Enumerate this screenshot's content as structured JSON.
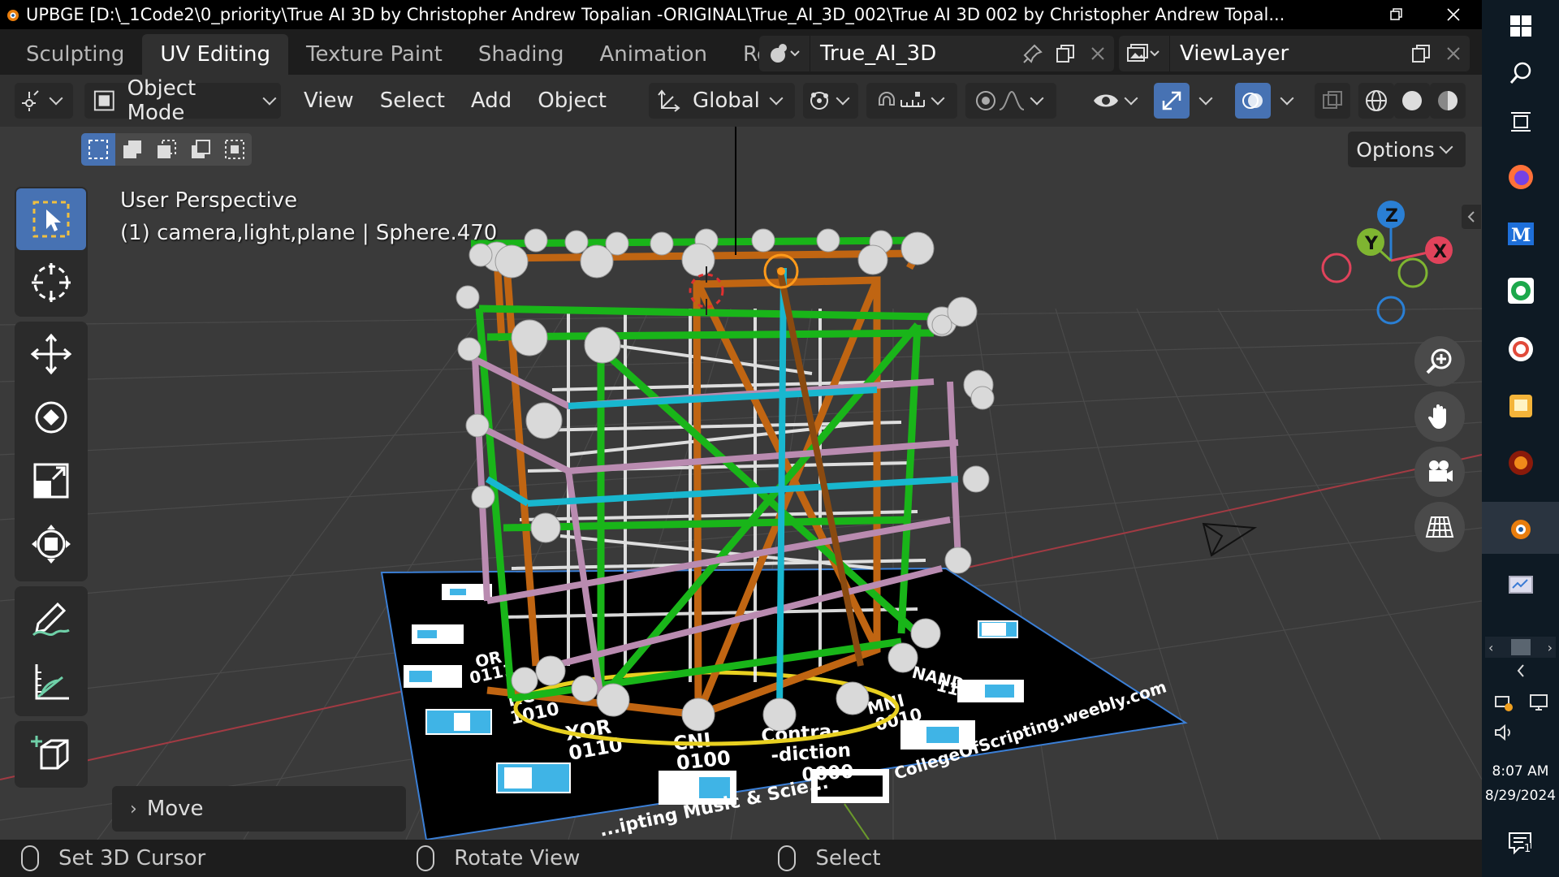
{
  "window": {
    "title": "UPBGE [D:\\_1Code2\\0_priority\\True AI 3D by Christopher Andrew Topalian -ORIGINAL\\True_AI_3D_002\\True AI 3D 002 by Christopher Andrew Topal..."
  },
  "workspaces": {
    "tabs": [
      "Sculpting",
      "UV Editing",
      "Texture Paint",
      "Shading",
      "Animation",
      "Re"
    ],
    "active": "UV Editing"
  },
  "scene": {
    "name": "True_AI_3D"
  },
  "view_layer": {
    "name": "ViewLayer"
  },
  "header": {
    "mode": "Object Mode",
    "menus": [
      "View",
      "Select",
      "Add",
      "Object"
    ],
    "transform_orientation": "Global"
  },
  "options_label": "Options",
  "viewport": {
    "view_name": "User Perspective",
    "collection_info": "(1) camera,light,plane | Sphere.470",
    "last_operator": "Move",
    "gizmo": {
      "x": "X",
      "y": "Y",
      "z": "Z"
    }
  },
  "plane_labels": {
    "xor": "XOR",
    "xor_bits": "0110",
    "cni": "CNI",
    "cni_bits": "0100",
    "contra1": "Contra-",
    "contra2": "-diction",
    "contra_bits": "0000",
    "mni": "MNI",
    "mni_bits": "0010",
    "nand": "NAND",
    "nand_bits": "1110",
    "rc": "RC",
    "rc_bits": "1010",
    "or": "OR",
    "or_bits": "0111",
    "site": "CollegeOfScripting.weebly.com",
    "footer": "...ipting Music & Scie..."
  },
  "statusbar": {
    "left": "Set 3D Cursor",
    "middle": "Rotate View",
    "right": "Select"
  },
  "taskbar": {
    "time": "8:07 AM",
    "date": "8/29/2024",
    "notifications": "1"
  },
  "colors": {
    "accent": "#4772b3",
    "frame_green": "#1fbf1f",
    "frame_brown": "#b05a12",
    "frame_pink": "#b98bb0",
    "frame_cyan": "#1ab8d0",
    "frame_orange": "#e0a020",
    "axis_x": "#e0435b",
    "axis_y": "#7fb531",
    "axis_z": "#2a7fd4"
  }
}
